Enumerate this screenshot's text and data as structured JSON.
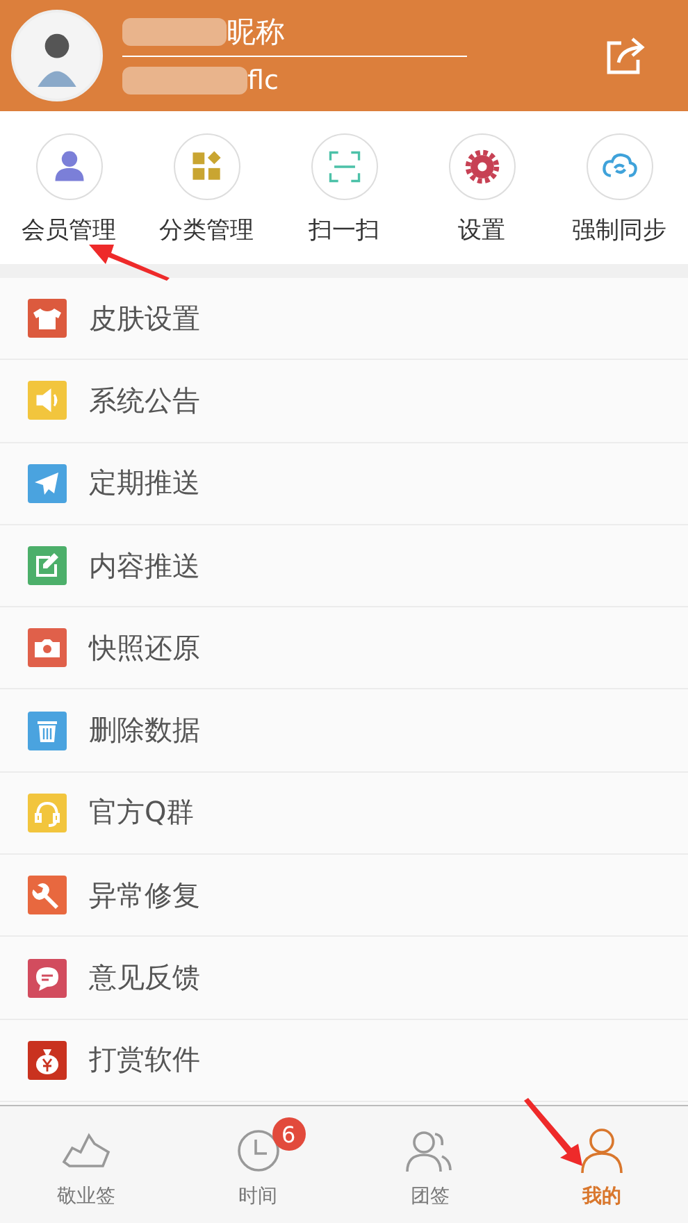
{
  "profile": {
    "nickname": "昵称",
    "account": "flc"
  },
  "quick_actions": [
    {
      "kind": "member",
      "label": "会员管理"
    },
    {
      "kind": "category",
      "label": "分类管理"
    },
    {
      "kind": "scan",
      "label": "扫一扫"
    },
    {
      "kind": "settings",
      "label": "设置"
    },
    {
      "kind": "sync",
      "label": "强制同步"
    }
  ],
  "menu": [
    {
      "kind": "shirt",
      "color": "#dc5a3e",
      "label": "皮肤设置"
    },
    {
      "kind": "speaker",
      "color": "#f2c53d",
      "label": "系统公告"
    },
    {
      "kind": "plane",
      "color": "#4aa3df",
      "label": "定期推送"
    },
    {
      "kind": "edit",
      "color": "#4caf6a",
      "label": "内容推送"
    },
    {
      "kind": "camera",
      "color": "#e0604a",
      "label": "快照还原"
    },
    {
      "kind": "trash",
      "color": "#4aa3df",
      "label": "删除数据"
    },
    {
      "kind": "headset",
      "color": "#f2c53d",
      "label": "官方Q群"
    },
    {
      "kind": "wrench",
      "color": "#e8683f",
      "label": "异常修复"
    },
    {
      "kind": "chat",
      "color": "#d24c5e",
      "label": "意见反馈"
    },
    {
      "kind": "moneybag",
      "color": "#c9321f",
      "label": "打赏软件"
    }
  ],
  "tabs": [
    {
      "kind": "note",
      "label": "敬业签",
      "selected": false
    },
    {
      "kind": "clock",
      "label": "时间",
      "selected": false,
      "badge": "6"
    },
    {
      "kind": "group",
      "label": "团签",
      "selected": false
    },
    {
      "kind": "person",
      "label": "我的",
      "selected": true
    }
  ]
}
